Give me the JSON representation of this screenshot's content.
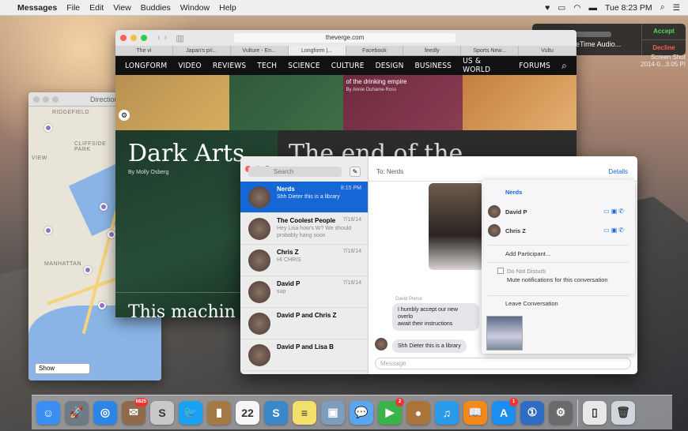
{
  "menubar": {
    "app_name": "Messages",
    "menus": [
      "File",
      "Edit",
      "View",
      "Buddies",
      "Window",
      "Help"
    ],
    "clock": "Tue 8:23 PM",
    "status_icons": [
      "vpn-icon",
      "airplay-icon",
      "wifi-icon",
      "battery-icon",
      "spotlight-icon",
      "notification-center-icon"
    ]
  },
  "facetime": {
    "subtitle": "FaceTime Audio...",
    "accept": "Accept",
    "decline": "Decline"
  },
  "desktop": {
    "screenshot_name": "Screen Shot",
    "screenshot_date": "2014-0...3.05 PI"
  },
  "maps": {
    "title": "Directions",
    "show_select": "Show",
    "labels": [
      "RIDGEFIELD",
      "CLIFFSIDE PARK",
      "VIEW",
      "MANHATTAN"
    ]
  },
  "safari": {
    "url": "theverge.com",
    "tabs": [
      "The vi",
      "Japan's pri...",
      "Vulture - En...",
      "Longform |...",
      "Facebook",
      "feedly",
      "Sports New...",
      "Vultu"
    ],
    "active_tab": 3,
    "nav": [
      "LONGFORM",
      "VIDEO",
      "REVIEWS",
      "TECH",
      "SCIENCE",
      "CULTURE",
      "DESIGN",
      "BUSINESS",
      "US & WORLD",
      "FORUMS"
    ],
    "hero_caption": "of the drinking empire",
    "hero_byline": "By Annie Duhame-Ross",
    "story1_title": "Dark Arts",
    "story1_byline": "By Molly Osberg",
    "story2_title": "The end of the",
    "story3_title": "This machin"
  },
  "messages": {
    "search_placeholder": "Search",
    "to_label": "To:",
    "to_value": "Nerds",
    "details": "Details",
    "input_placeholder": "Message",
    "conversations": [
      {
        "name": "Nerds",
        "time": "8:15 PM",
        "preview": "Shh Dieter this is a library",
        "selected": true
      },
      {
        "name": "The Coolest People",
        "time": "7/18/14",
        "preview": "Hey Lisa how's W? We should probably hang soon",
        "selected": false
      },
      {
        "name": "Chris Z",
        "time": "7/18/14",
        "preview": "HI CHRIS",
        "selected": false
      },
      {
        "name": "David P",
        "time": "7/18/14",
        "preview": "sup",
        "selected": false
      },
      {
        "name": "David P and Chris Z",
        "time": "",
        "preview": "",
        "selected": false
      },
      {
        "name": "David P and Lisa B",
        "time": "",
        "preview": "",
        "selected": false
      }
    ],
    "sender_name": "David Pierce",
    "bubble1": "I humbly accept our new overlo",
    "bubble1b": "await their instructions",
    "bubble2": "Shh Dieter this is a library"
  },
  "details_popover": {
    "title": "Nerds",
    "participants": [
      {
        "name": "David P"
      },
      {
        "name": "Chris Z"
      }
    ],
    "add_participant": "Add Participant...",
    "dnd": "Do Not Disturb",
    "dnd_desc": "Mute notifications for this conversation",
    "leave": "Leave Conversation"
  },
  "dock": {
    "apps": [
      {
        "name": "finder",
        "glyph": "☺",
        "color": "#3b8ff2",
        "badge": ""
      },
      {
        "name": "launchpad",
        "glyph": "🚀",
        "color": "#6e7a86",
        "badge": ""
      },
      {
        "name": "safari",
        "glyph": "◎",
        "color": "#2d86e6",
        "badge": ""
      },
      {
        "name": "mail",
        "glyph": "✉",
        "color": "#8f6b4b",
        "badge": "6825"
      },
      {
        "name": "sublime",
        "glyph": "S",
        "color": "#c9c9c9",
        "badge": ""
      },
      {
        "name": "twitter",
        "glyph": "🐦",
        "color": "#1ca1f2",
        "badge": ""
      },
      {
        "name": "notebook",
        "glyph": "▮",
        "color": "#a37a46",
        "badge": ""
      },
      {
        "name": "calendar",
        "glyph": "22",
        "color": "#f6f6f6",
        "badge": ""
      },
      {
        "name": "simplenote",
        "glyph": "S",
        "color": "#3a87c9",
        "badge": ""
      },
      {
        "name": "notes",
        "glyph": "≡",
        "color": "#f5e06d",
        "badge": ""
      },
      {
        "name": "preview",
        "glyph": "▣",
        "color": "#7e9dbd",
        "badge": ""
      },
      {
        "name": "messages",
        "glyph": "💬",
        "color": "#5aa7f0",
        "badge": ""
      },
      {
        "name": "facetime",
        "glyph": "▶",
        "color": "#3bb34a",
        "badge": "2"
      },
      {
        "name": "cyberduck",
        "glyph": "●",
        "color": "#a9743a",
        "badge": ""
      },
      {
        "name": "itunes",
        "glyph": "♫",
        "color": "#2b9ae9",
        "badge": ""
      },
      {
        "name": "ibooks",
        "glyph": "📖",
        "color": "#f18a1c",
        "badge": ""
      },
      {
        "name": "app-store",
        "glyph": "A",
        "color": "#1b8ef0",
        "badge": "1"
      },
      {
        "name": "1password",
        "glyph": "①",
        "color": "#2f6cc3",
        "badge": ""
      },
      {
        "name": "system-preferences",
        "glyph": "⚙",
        "color": "#6a6a6a",
        "badge": ""
      },
      {
        "name": "document",
        "glyph": "▯",
        "color": "#e8e8e8",
        "badge": ""
      },
      {
        "name": "trash",
        "glyph": "🗑",
        "color": "#cfd5db",
        "badge": ""
      }
    ]
  }
}
